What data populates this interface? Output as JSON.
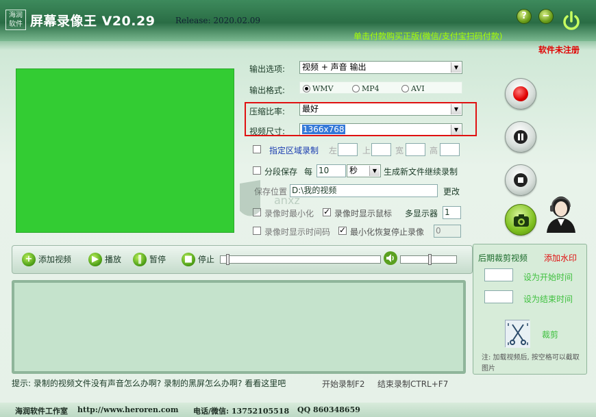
{
  "header": {
    "logo_line1": "海润",
    "logo_line2": "软件",
    "app_title": "屏幕录像王 V20.29",
    "release": "Release: 2020.02.09",
    "buy_text": "单击付款购买正版(微信/支付宝扫码付款)",
    "unregistered": "软件未注册",
    "help_symbol": "?",
    "minimize_symbol": "−"
  },
  "settings": {
    "output_option_label": "输出选项:",
    "output_option_value": "视频 + 声音 输出",
    "output_format_label": "输出格式:",
    "formats": [
      "WMV",
      "MP4",
      "AVI"
    ],
    "selected_format": "WMV",
    "compression_label": "压缩比率:",
    "compression_value": "最好",
    "video_size_label": "视频尺寸:",
    "video_size_value": "1366x768",
    "region_label": "指定区域录制",
    "left_label": "左",
    "top_label": "上",
    "width_label": "宽",
    "height_label": "高",
    "segment_label": "分段保存",
    "every_label": "每",
    "segment_value": "10",
    "segment_unit": "秒",
    "segment_suffix": "生成新文件继续录制",
    "save_path_label": "保存位置",
    "save_path_value": "D:\\我的视频",
    "change_label": "更改",
    "minimize_when_recording": "录像时最小化",
    "show_cursor": "录像时显示鼠标",
    "multi_display_label": "多显示器",
    "multi_display_value": "1",
    "show_time": "录像时显示时间码",
    "restore_stop": "最小化恢复停止录像",
    "stop_value": "0"
  },
  "toolbar": {
    "add_video": "添加视频",
    "play": "播放",
    "pause": "暂停",
    "stop": "停止"
  },
  "right_panel": {
    "post_cut": "后期裁剪视频",
    "add_watermark": "添加水印",
    "set_start": "设为开始时间",
    "set_end": "设为结束时间",
    "cut": "裁剪",
    "note": "注: 加载视频后, 按空格可以截取图片"
  },
  "hint": {
    "text": "提示: 录制的视频文件没有声音怎么办啊? 录制的黑屏怎么办啊? 看看这里吧",
    "start_record": "开始录制F2",
    "end_record": "结束录制CTRL+F7"
  },
  "footer": {
    "studio": "海润软件工作室",
    "url": "http://www.heroren.com",
    "phone": "电话/微信: 13752105518",
    "qq": "QQ 860348659"
  },
  "colors": {
    "preview_green": "#33cc33",
    "highlight_red": "#e01010",
    "record_red": "#e00000",
    "selection_blue": "#3478d8"
  }
}
